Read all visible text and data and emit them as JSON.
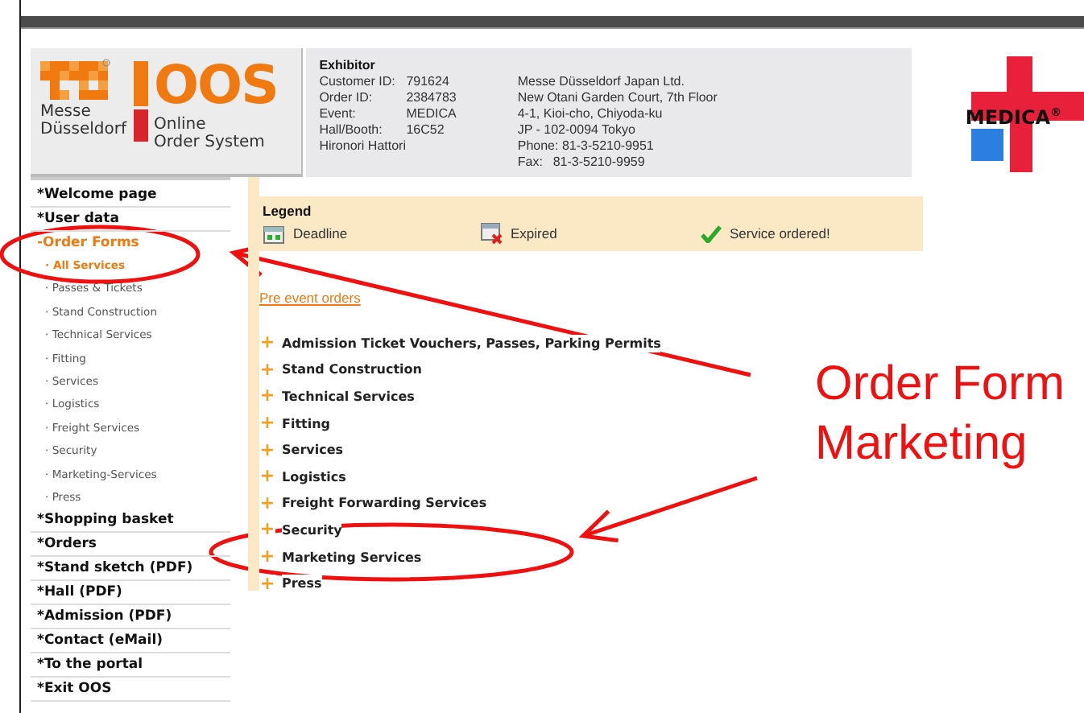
{
  "header": {
    "logo": {
      "brand_mark": "OOS",
      "company_lines": [
        "Messe",
        "Düsseldorf"
      ],
      "product_lines": [
        "Online",
        "Order System"
      ]
    },
    "exhibitor": {
      "title": "Exhibitor",
      "fields": [
        {
          "label": "Customer ID:",
          "value": "791624"
        },
        {
          "label": "Order ID:",
          "value": "2384783"
        },
        {
          "label": "Event:",
          "value": "MEDICA"
        },
        {
          "label": "Hall/Booth:",
          "value": "16C52"
        }
      ],
      "contact": "Hironori Hattori",
      "address_lines": [
        "Messe Düsseldorf Japan Ltd.",
        "New Otani Garden Court, 7th Floor",
        "4-1, Kioi-cho, Chiyoda-ku",
        "JP - 102-0094 Tokyo",
        "Phone: 81-3-5210-9951"
      ],
      "fax": {
        "label": "Fax:",
        "value": "81-3-5210-9959"
      }
    },
    "event_logo": {
      "text": "MEDICA",
      "mark": "®"
    }
  },
  "sidebar": {
    "items": [
      {
        "kind": "main",
        "marker": "*",
        "label": "Welcome page",
        "selected": false
      },
      {
        "kind": "main",
        "marker": "*",
        "label": "User data",
        "selected": false
      },
      {
        "kind": "main",
        "marker": "-",
        "label": "Order Forms",
        "selected": true
      },
      {
        "kind": "sub",
        "marker": "·",
        "label": "All Services",
        "selected": true
      },
      {
        "kind": "sub",
        "marker": "·",
        "label": "Passes & Tickets",
        "selected": false
      },
      {
        "kind": "sub",
        "marker": "·",
        "label": "Stand Construction",
        "selected": false
      },
      {
        "kind": "sub",
        "marker": "·",
        "label": "Technical Services",
        "selected": false
      },
      {
        "kind": "sub",
        "marker": "·",
        "label": "Fitting",
        "selected": false
      },
      {
        "kind": "sub",
        "marker": "·",
        "label": "Services",
        "selected": false
      },
      {
        "kind": "sub",
        "marker": "·",
        "label": "Logistics",
        "selected": false
      },
      {
        "kind": "sub",
        "marker": "·",
        "label": "Freight Services",
        "selected": false
      },
      {
        "kind": "sub",
        "marker": "·",
        "label": "Security",
        "selected": false
      },
      {
        "kind": "sub",
        "marker": "·",
        "label": "Marketing-Services",
        "selected": false
      },
      {
        "kind": "sub",
        "marker": "·",
        "label": "Press",
        "selected": false
      },
      {
        "kind": "main",
        "marker": "*",
        "label": "Shopping basket",
        "selected": false
      },
      {
        "kind": "main",
        "marker": "*",
        "label": "Orders",
        "selected": false
      },
      {
        "kind": "main",
        "marker": "*",
        "label": "Stand sketch (PDF)",
        "selected": false
      },
      {
        "kind": "main",
        "marker": "*",
        "label": "Hall (PDF)",
        "selected": false
      },
      {
        "kind": "main",
        "marker": "*",
        "label": "Admission (PDF)",
        "selected": false
      },
      {
        "kind": "main",
        "marker": "*",
        "label": "Contact (eMail)",
        "selected": false
      },
      {
        "kind": "main",
        "marker": "*",
        "label": "To the portal",
        "selected": false
      },
      {
        "kind": "main",
        "marker": "*",
        "label": "Exit OOS",
        "selected": false
      }
    ]
  },
  "legend": {
    "title": "Legend",
    "items": [
      {
        "kind": "deadline",
        "label": "Deadline"
      },
      {
        "kind": "expired",
        "label": "Expired"
      },
      {
        "kind": "ordered",
        "label": "Service ordered!"
      }
    ]
  },
  "orders": {
    "section_link": "Pre event orders",
    "expander": "+",
    "categories": [
      "Admission Ticket Vouchers, Passes, Parking Permits",
      "Stand Construction",
      "Technical Services",
      "Fitting",
      "Services",
      "Logistics",
      "Freight Forwarding Services",
      "Security",
      "Marketing Services",
      "Press"
    ]
  },
  "annotation": {
    "lines": [
      "Order Form",
      "Marketing"
    ]
  }
}
